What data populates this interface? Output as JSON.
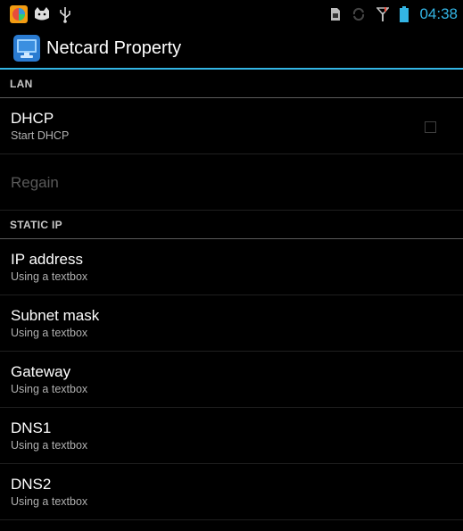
{
  "status_bar": {
    "time": "04:38",
    "left_icons": [
      "color-app-icon",
      "cat-icon",
      "usb-icon"
    ],
    "right_icons": [
      "sim-icon",
      "sync-icon",
      "signal-icon",
      "battery-icon"
    ]
  },
  "action_bar": {
    "title": "Netcard Property"
  },
  "sections": {
    "lan": {
      "header": "LAN",
      "dhcp": {
        "title": "DHCP",
        "summary": "Start DHCP",
        "checked": false
      },
      "regain": {
        "title": "Regain",
        "enabled": false
      }
    },
    "static_ip": {
      "header": "STATIC IP",
      "items": [
        {
          "title": "IP address",
          "summary": "Using a textbox"
        },
        {
          "title": "Subnet mask",
          "summary": "Using a textbox"
        },
        {
          "title": "Gateway",
          "summary": "Using a textbox"
        },
        {
          "title": "DNS1",
          "summary": "Using a textbox"
        },
        {
          "title": "DNS2",
          "summary": "Using a textbox"
        }
      ]
    }
  },
  "colors": {
    "accent": "#33b5e5",
    "background": "#000000"
  }
}
